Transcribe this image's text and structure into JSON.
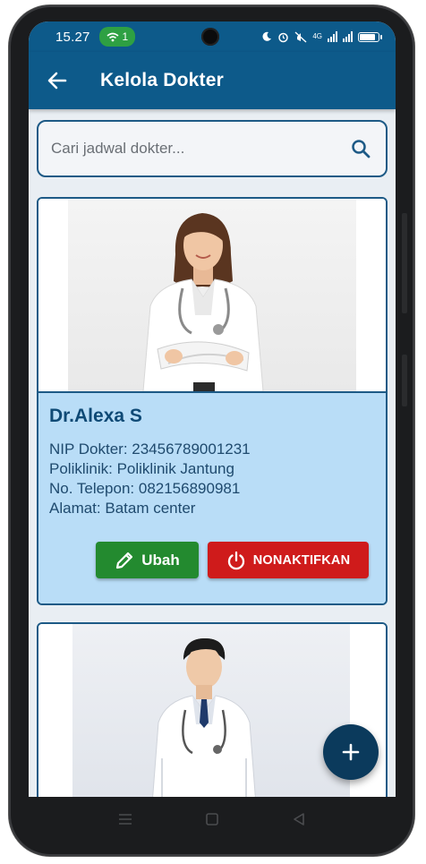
{
  "status_bar": {
    "time": "15.27",
    "wifi_badge": "1",
    "network_label": "4G"
  },
  "app_bar": {
    "title": "Kelola Dokter"
  },
  "search": {
    "placeholder": "Cari jadwal dokter...",
    "value": ""
  },
  "doctors": [
    {
      "name": "Dr.Alexa S",
      "nip": "NIP Dokter: 23456789001231",
      "poliklinik": "Poliklinik: Poliklinik Jantung",
      "telepon": "No. Telepon: 082156890981",
      "alamat": "Alamat: Batam center",
      "edit_label": "Ubah",
      "deactivate_label": "NONAKTIFKAN"
    }
  ],
  "icons": {
    "back": "arrow-left-icon",
    "search": "search-icon",
    "edit": "pencil-icon",
    "deactivate": "power-icon",
    "add": "plus-icon"
  },
  "colors": {
    "primary": "#0d5a8a",
    "card_info_bg": "#b9ddf7",
    "edit_button": "#238a2f",
    "deactivate_button": "#cf1b1b",
    "fab": "#0b3a5c"
  }
}
